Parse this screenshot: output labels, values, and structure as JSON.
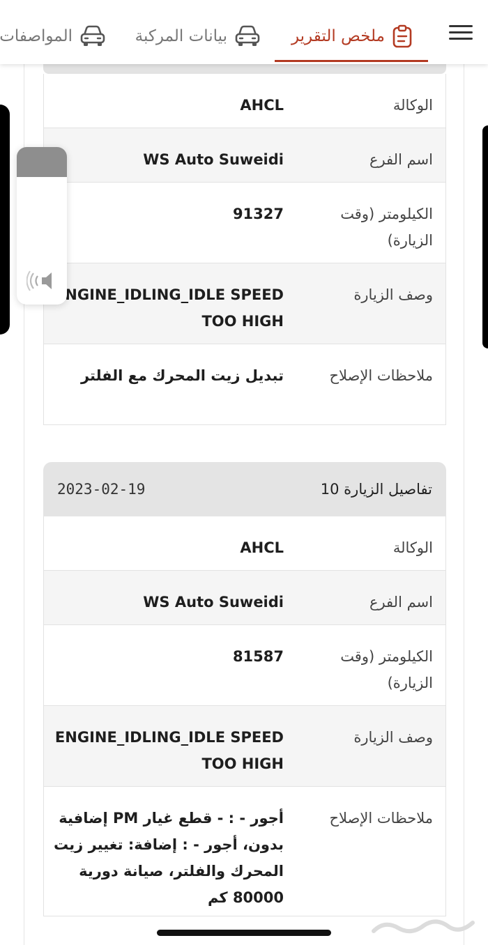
{
  "tabs": [
    {
      "label": "ملخص التقرير",
      "icon": "clipboard-icon",
      "active": true
    },
    {
      "label": "بيانات المركبة",
      "icon": "car-icon",
      "active": false
    },
    {
      "label": "المواصفات",
      "icon": "car-icon",
      "active": false
    }
  ],
  "accent_color": "#b33a22",
  "visit_a": {
    "rows": [
      {
        "label": "الوكالة",
        "value": "AHCL"
      },
      {
        "label": "اسم الفرع",
        "value": "WS Auto Suweidi"
      },
      {
        "label": "الكيلومتر (وقت الزيارة)",
        "value": "91327"
      },
      {
        "label": "وصف الزيارة",
        "value": "ENGINE_IDLING_IDLE SPEED TOO HIGH"
      },
      {
        "label": "ملاحظات الإصلاح",
        "value": "تبديل زيت المحرك مع الفلتر"
      }
    ]
  },
  "visit_b": {
    "title": "تفاصيل الزيارة 10",
    "date": "2023-02-19",
    "rows": [
      {
        "label": "الوكالة",
        "value": "AHCL"
      },
      {
        "label": "اسم الفرع",
        "value": "WS Auto Suweidi"
      },
      {
        "label": "الكيلومتر (وقت الزيارة)",
        "value": "81587"
      },
      {
        "label": "وصف الزيارة",
        "value": "ENGINE_IDLING_IDLE SPEED TOO HIGH"
      },
      {
        "label": "ملاحظات الإصلاح",
        "value": "أجور - : - قطع غيار PM إضافية بدون، أجور - : إضافة: تغيير زيت المحرك والفلتر، صيانة دورية 80000 كم"
      }
    ]
  },
  "volume_level": 0.19
}
